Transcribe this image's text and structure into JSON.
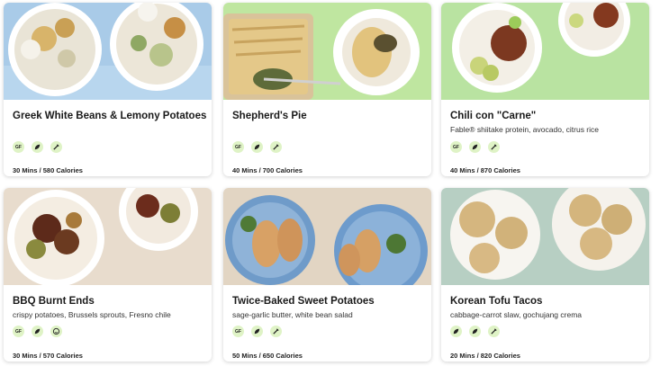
{
  "recipes": [
    {
      "title": "Greek White Beans & Lemony Potatoes",
      "subtitle": "",
      "meta": "30 Mins / 580 Calories",
      "tags": [
        "gluten-free-icon",
        "leaf-icon",
        "pepper-icon"
      ],
      "bg": "#a9cbe8"
    },
    {
      "title": "Shepherd's Pie",
      "subtitle": "",
      "meta": "40 Mins / 700 Calories",
      "tags": [
        "gluten-free-icon",
        "leaf-icon",
        "pepper-icon"
      ],
      "bg": "#bfe6a0"
    },
    {
      "title": "Chili con \"Carne\"",
      "subtitle": "Fable® shiitake protein, avocado, citrus rice",
      "meta": "40 Mins / 870 Calories",
      "tags": [
        "gluten-free-icon",
        "leaf-icon",
        "pepper-icon"
      ],
      "bg": "#b9e3a1"
    },
    {
      "title": "BBQ Burnt Ends",
      "subtitle": "crispy potatoes, Brussels sprouts, Fresno chile",
      "meta": "30 Mins / 570 Calories",
      "tags": [
        "gluten-free-icon",
        "leaf-icon",
        "smile-icon"
      ],
      "bg": "#e8dccd"
    },
    {
      "title": "Twice-Baked Sweet Potatoes",
      "subtitle": "sage-garlic butter, white bean salad",
      "meta": "50 Mins / 650 Calories",
      "tags": [
        "gluten-free-icon",
        "leaf-icon",
        "pepper-icon"
      ],
      "bg": "#e2d5c3"
    },
    {
      "title": "Korean Tofu Tacos",
      "subtitle": "cabbage-carrot slaw, gochujang crema",
      "meta": "20 Mins / 820 Calories",
      "tags": [
        "leaf-icon",
        "leaf-icon",
        "pepper-icon"
      ],
      "bg": "#b7cfc3"
    }
  ],
  "gf_label": "GF",
  "colors": {
    "tag_bg": "#dff3c6",
    "text": "#1f1f1f"
  }
}
